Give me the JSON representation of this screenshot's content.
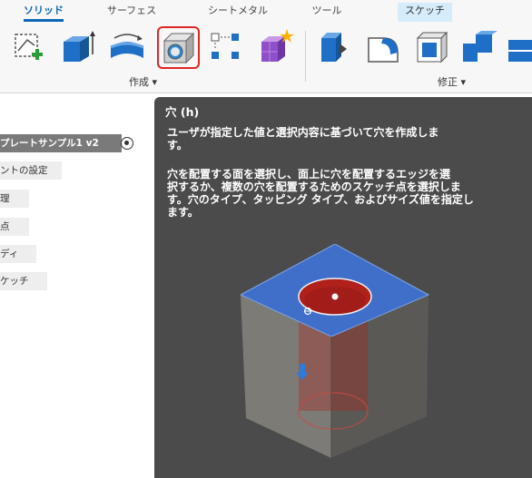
{
  "ribbon": {
    "tabs": [
      "ソリッド",
      "サーフェス",
      "シートメタル",
      "ツール",
      "スケッチ"
    ],
    "groups": {
      "create": "作成 ▾",
      "modify": "修正 ▾"
    },
    "tools": [
      "create-sketch",
      "extrude",
      "revolve",
      "hole",
      "pattern",
      "create-form",
      "press-pull",
      "fillet",
      "shell",
      "combine",
      "split"
    ],
    "selected_tool": "hole"
  },
  "browser": {
    "document_name": "プレートサンプル1 v2",
    "items": [
      "ントの設定",
      "理",
      "点",
      "ディ",
      "ケッチ"
    ]
  },
  "tooltip": {
    "title": "穴 (h)",
    "summary": "ユーザが指定した値と選択内容に基づいて穴を作成しま\nす。",
    "detail": "穴を配置する面を選択し、面上に穴を配置するエッジを選\n択するか、複数の穴を配置するためのスケッチ点を選択しま\nす。穴のタイプ、タッピング タイプ、およびサイズ値を指定し\nます。"
  },
  "colors": {
    "accent": "#0b67b5",
    "tooltip_bg": "#4b4b4b",
    "selection": "#e02525",
    "face_blue": "#3f6fc9",
    "hole_red": "#b0211c"
  }
}
